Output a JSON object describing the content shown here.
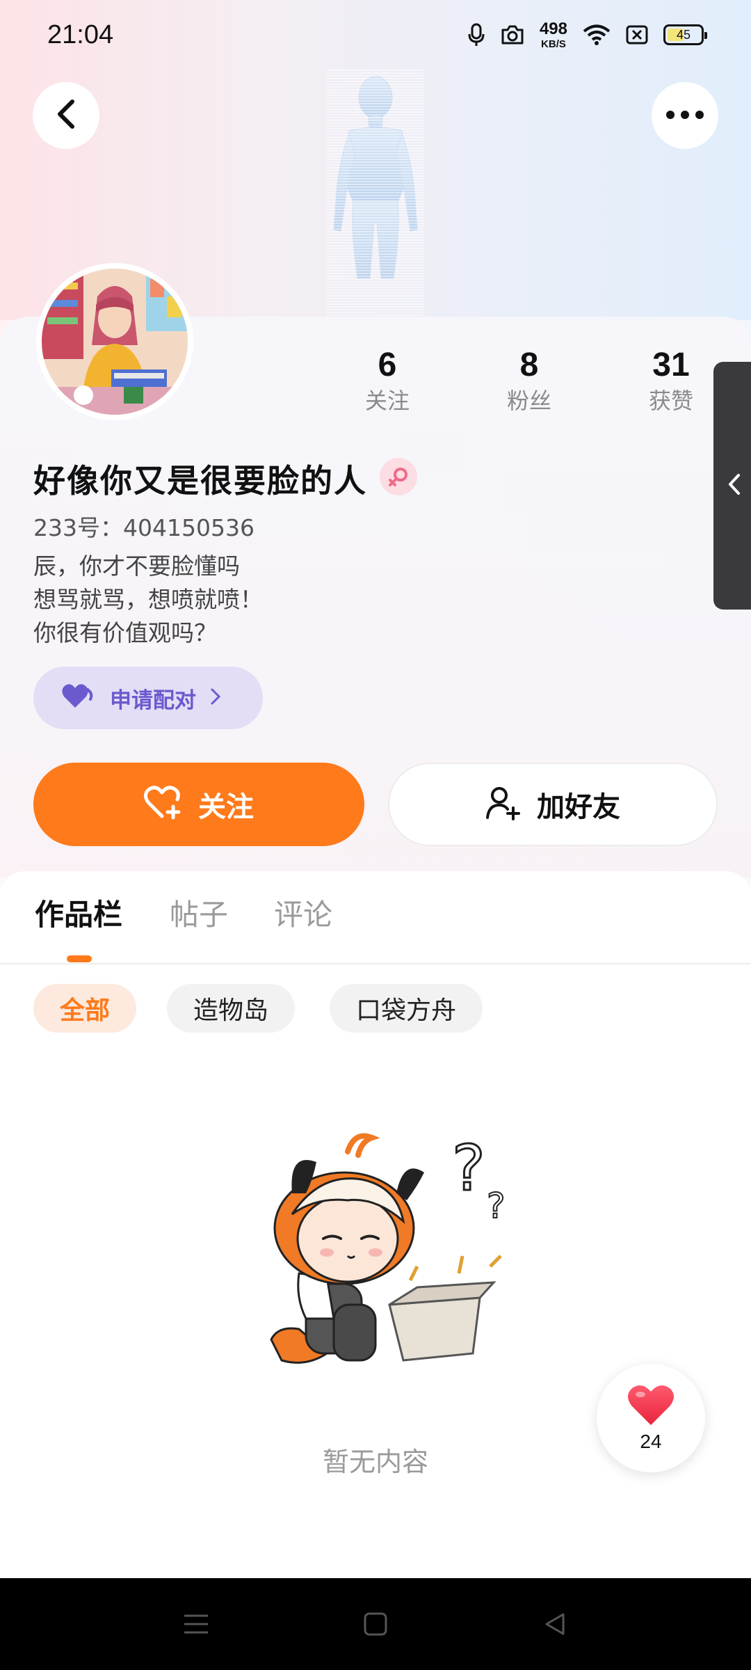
{
  "status_bar": {
    "time": "21:04",
    "net_speed_value": "498",
    "net_speed_unit": "KB/S",
    "battery_level": "45",
    "icons": [
      "mic-icon",
      "camera-icon",
      "wifi-icon",
      "sim-off-icon",
      "battery-icon"
    ]
  },
  "header": {
    "back_icon": "chevron-left-icon",
    "more_icon": "more-dots-icon"
  },
  "profile": {
    "stats": [
      {
        "value": "6",
        "label": "关注"
      },
      {
        "value": "8",
        "label": "粉丝"
      },
      {
        "value": "31",
        "label": "获赞"
      }
    ],
    "nickname": "好像你又是很要脸的人",
    "gender": "female",
    "uid": "233号：404150536",
    "bio_lines": [
      "辰，你才不要脸懂吗",
      "想骂就骂，想喷就喷！",
      "你很有价值观吗？"
    ],
    "pair_label": "申请配对",
    "follow_label": "关注",
    "add_friend_label": "加好友"
  },
  "tabs": [
    {
      "label": "作品栏",
      "active": true
    },
    {
      "label": "帖子",
      "active": false
    },
    {
      "label": "评论",
      "active": false
    }
  ],
  "filters": [
    {
      "label": "全部",
      "active": true
    },
    {
      "label": "造物岛",
      "active": false
    },
    {
      "label": "口袋方舟",
      "active": false
    }
  ],
  "empty_state": {
    "text": "暂无内容"
  },
  "like_button": {
    "count": "24"
  },
  "colors": {
    "accent": "#ff7a1a",
    "pair": "#6a5acd",
    "like": "#f2344d"
  }
}
